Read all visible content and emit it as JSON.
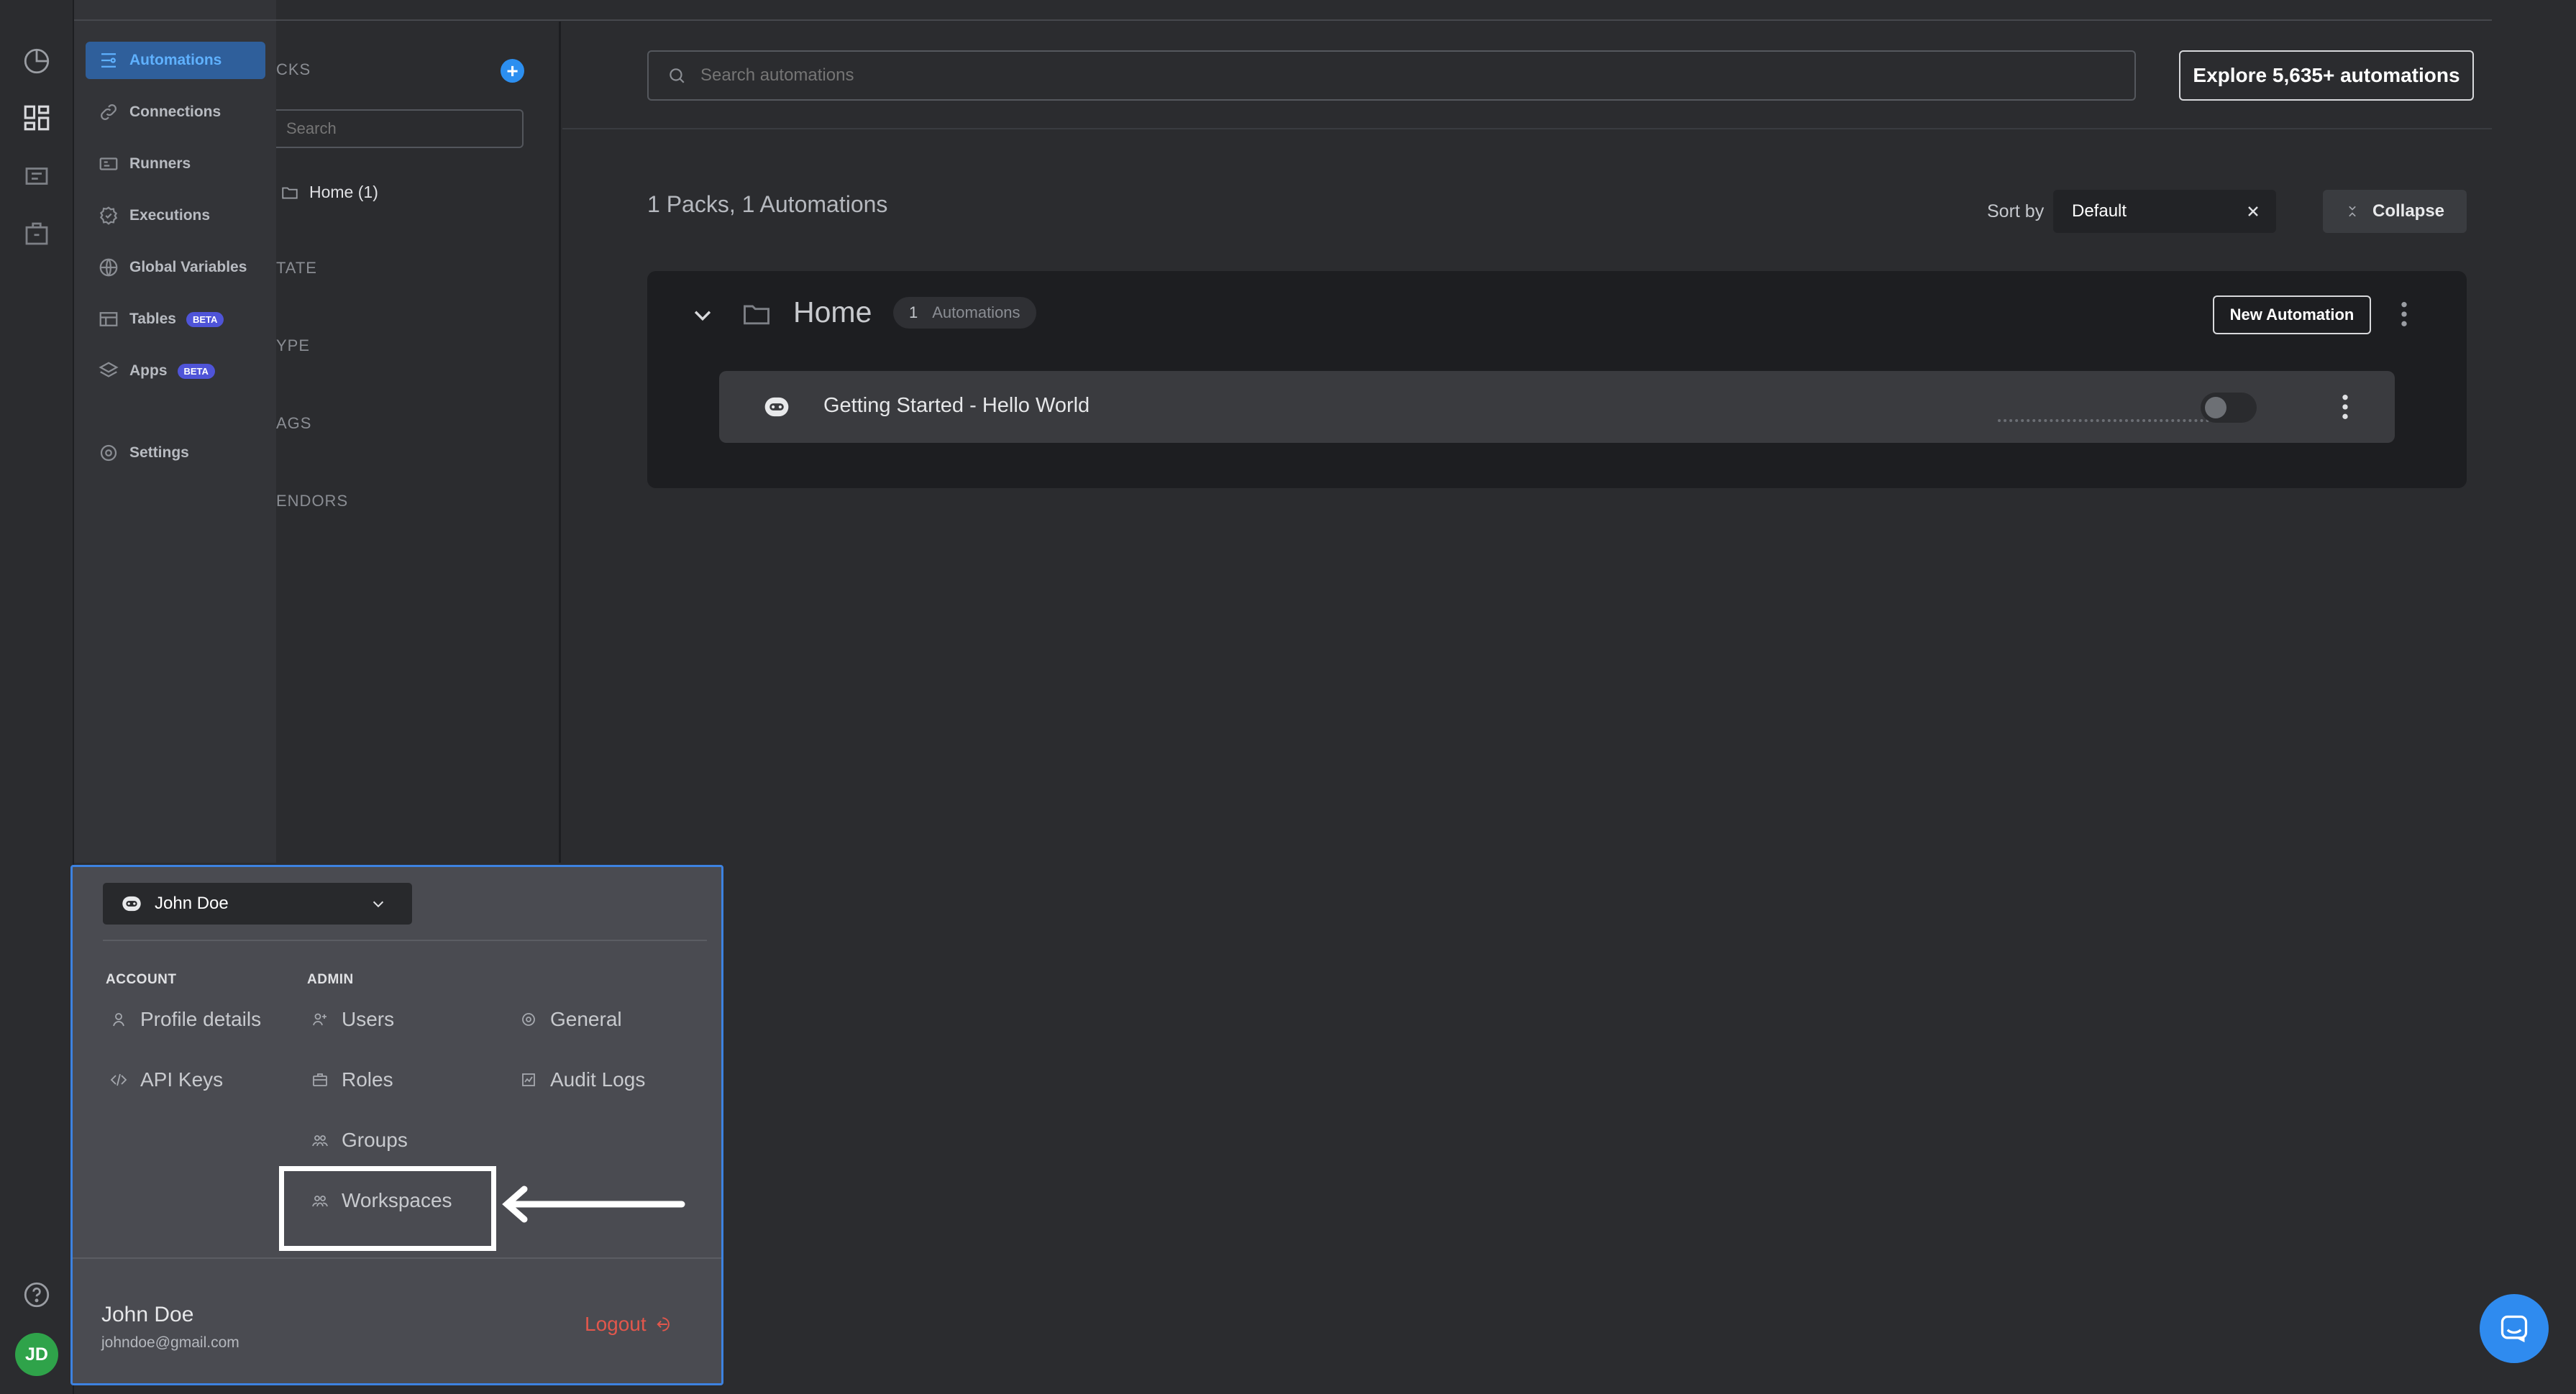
{
  "nav": {
    "items": [
      {
        "label": "Automations",
        "icon": "automations-icon",
        "active": true
      },
      {
        "label": "Connections",
        "icon": "link-icon"
      },
      {
        "label": "Runners",
        "icon": "runner-icon"
      },
      {
        "label": "Executions",
        "icon": "executions-icon"
      },
      {
        "label": "Global Variables",
        "icon": "globe-icon"
      },
      {
        "label": "Tables",
        "icon": "table-icon",
        "badge": "BETA"
      },
      {
        "label": "Apps",
        "icon": "layers-icon",
        "badge": "BETA"
      },
      {
        "label": "Settings",
        "icon": "gear-icon"
      }
    ]
  },
  "packs_panel": {
    "header": "CKS",
    "search_placeholder": "Search",
    "home_item": "Home (1)",
    "filters": [
      "TATE",
      "YPE",
      "AGS",
      "ENDORS"
    ]
  },
  "main": {
    "search_placeholder": "Search automations",
    "explore_button": "Explore 5,635+ automations",
    "summary": "1 Packs, 1 Automations",
    "sort_label": "Sort by",
    "sort_value": "Default",
    "collapse_button": "Collapse",
    "pack": {
      "name": "Home",
      "count": "1",
      "count_label": "Automations",
      "new_automation_button": "New Automation",
      "automation_name": "Getting Started - Hello World"
    }
  },
  "account_popover": {
    "selected_user": "John Doe",
    "account_heading": "ACCOUNT",
    "admin_heading": "ADMIN",
    "account_items": [
      "Profile details",
      "API Keys"
    ],
    "admin_items": [
      "Users",
      "Roles",
      "Groups",
      "Workspaces"
    ],
    "other_items": [
      "General",
      "Audit Logs"
    ],
    "user_name": "John Doe",
    "user_email": "johndoe@gmail.com",
    "logout": "Logout"
  },
  "avatar_initials": "JD",
  "colors": {
    "accent_blue": "#2c8ff0",
    "active_nav_bg": "#2f5f9b",
    "beta_badge": "#4f54d8",
    "logout_red": "#e2574c",
    "avatar_green": "#2fa34a"
  }
}
